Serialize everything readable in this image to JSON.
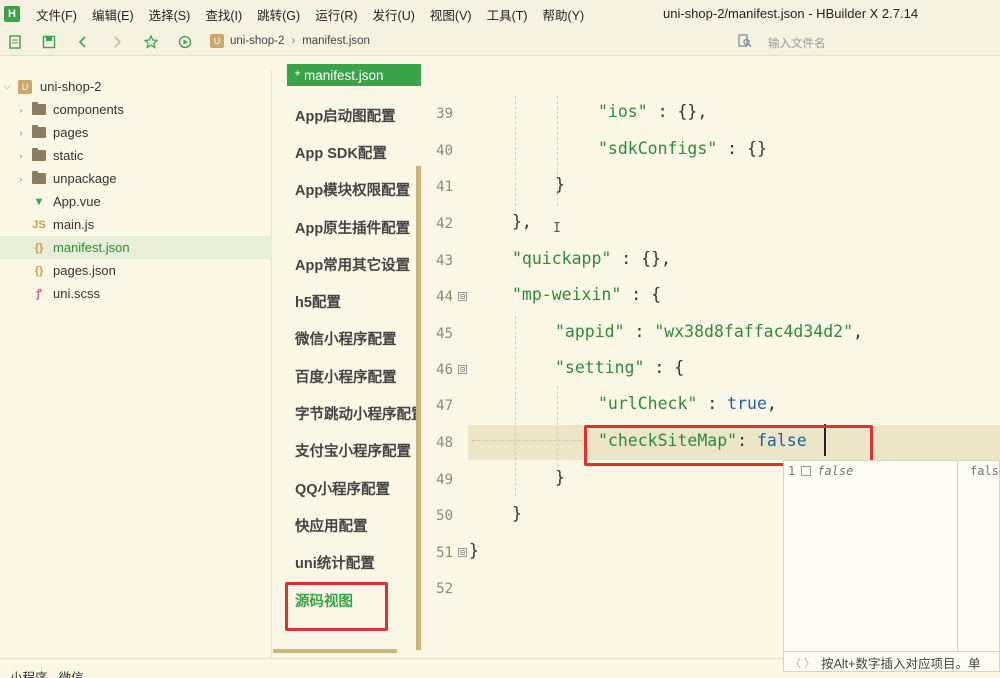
{
  "menubar": {
    "app_icon": "H",
    "items": [
      "文件(F)",
      "编辑(E)",
      "选择(S)",
      "查找(I)",
      "跳转(G)",
      "运行(R)",
      "发行(U)",
      "视图(V)",
      "工具(T)",
      "帮助(Y)"
    ],
    "window_title": "uni-shop-2/manifest.json - HBuilder X 2.7.14"
  },
  "toolbar": {
    "icons": [
      "new-file-icon",
      "save-icon",
      "back-icon",
      "forward-icon",
      "star-icon",
      "run-icon"
    ],
    "breadcrumb": {
      "project_icon": "U",
      "project": "uni-shop-2",
      "file": "manifest.json"
    },
    "file_search_placeholder": "输入文件名"
  },
  "tree": {
    "project_name": "uni-shop-2",
    "items": [
      {
        "label": "components",
        "type": "folder"
      },
      {
        "label": "pages",
        "type": "folder"
      },
      {
        "label": "static",
        "type": "folder"
      },
      {
        "label": "unpackage",
        "type": "folder"
      },
      {
        "label": "App.vue",
        "type": "vue"
      },
      {
        "label": "main.js",
        "type": "js"
      },
      {
        "label": "manifest.json",
        "type": "json",
        "selected": true
      },
      {
        "label": "pages.json",
        "type": "json"
      },
      {
        "label": "uni.scss",
        "type": "scss"
      }
    ]
  },
  "tab": {
    "label": "* manifest.json"
  },
  "config_nav": {
    "items": [
      "App启动图配置",
      "App SDK配置",
      "App模块权限配置",
      "App原生插件配置",
      "App常用其它设置",
      "h5配置",
      "微信小程序配置",
      "百度小程序配置",
      "字节跳动小程序配置",
      "支付宝小程序配置",
      "QQ小程序配置",
      "快应用配置",
      "uni统计配置",
      "源码视图"
    ],
    "active": "源码视图"
  },
  "editor": {
    "line_numbers": [
      "39",
      "40",
      "41",
      "42",
      "43",
      "44",
      "45",
      "46",
      "47",
      "48",
      "49",
      "50",
      "51",
      "52"
    ],
    "fold_markers": [
      "⊟",
      "⊟",
      "⊟"
    ],
    "tokens": {
      "l39_key": "\"ios\"",
      "l39_rest": " : {},",
      "l40_key": "\"sdkConfigs\"",
      "l40_rest": " : {}",
      "l41": "}",
      "l42": "},",
      "l43_key": "\"quickapp\"",
      "l43_rest": " : {},",
      "l44_key": "\"mp-weixin\"",
      "l44_rest": " : {",
      "l45_key": "\"appid\"",
      "l45_mid": " : ",
      "l45_val": "\"wx38d8faffac4d34d2\"",
      "l45_end": ",",
      "l46_key": "\"setting\"",
      "l46_rest": " : {",
      "l47_key": "\"urlCheck\"",
      "l47_mid": " : ",
      "l47_val": "true",
      "l47_end": ",",
      "l48_key": "\"checkSiteMap\"",
      "l48_mid": ": ",
      "l48_val": "false",
      "l49": "}",
      "l50": "}",
      "l51": "}"
    },
    "ibeam": "I"
  },
  "autocomplete": {
    "index": "1",
    "item": "false",
    "side": "false",
    "hint": "按Alt+数字插入对应项目。单"
  },
  "bottom_status": "小程序 - 微信",
  "colors": {
    "accent_green": "#3aa34a",
    "highlight_red": "#e03030",
    "string_green": "#2f8a3f",
    "bool_blue": "#1f5fa8",
    "background": "#fbf7e6"
  }
}
